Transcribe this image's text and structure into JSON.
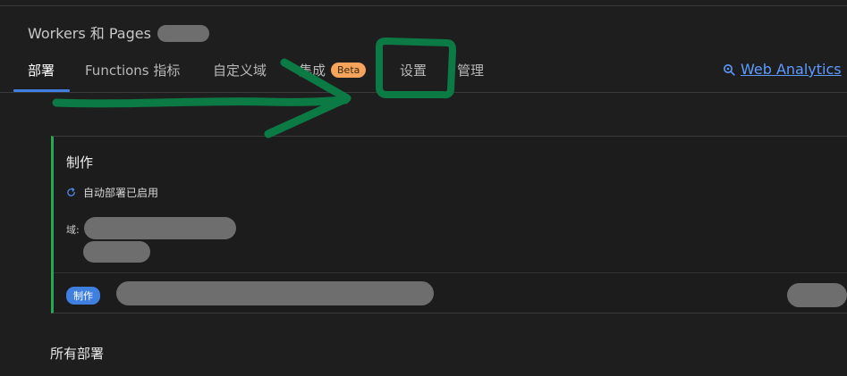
{
  "header": {
    "breadcrumb": "Workers 和 Pages"
  },
  "tabs": [
    {
      "label": "部署",
      "active": true
    },
    {
      "label": "Functions 指标"
    },
    {
      "label": "自定义域"
    },
    {
      "label": "集成",
      "badge": "Beta"
    },
    {
      "label": "设置"
    },
    {
      "label": "管理"
    }
  ],
  "web_analytics": {
    "label": "Web Analytics",
    "icon": "search-icon"
  },
  "production_card": {
    "title": "制作",
    "auto_deploy": "自动部署已启用",
    "domain_label": "域:",
    "badge": "制作"
  },
  "all_deployments": {
    "title": "所有部署"
  },
  "colors": {
    "accent": "#3f7fe0",
    "link": "#5e9bff",
    "beta": "#f6a35b",
    "card_border": "#2aa851",
    "annotation": "#0b7a45"
  }
}
